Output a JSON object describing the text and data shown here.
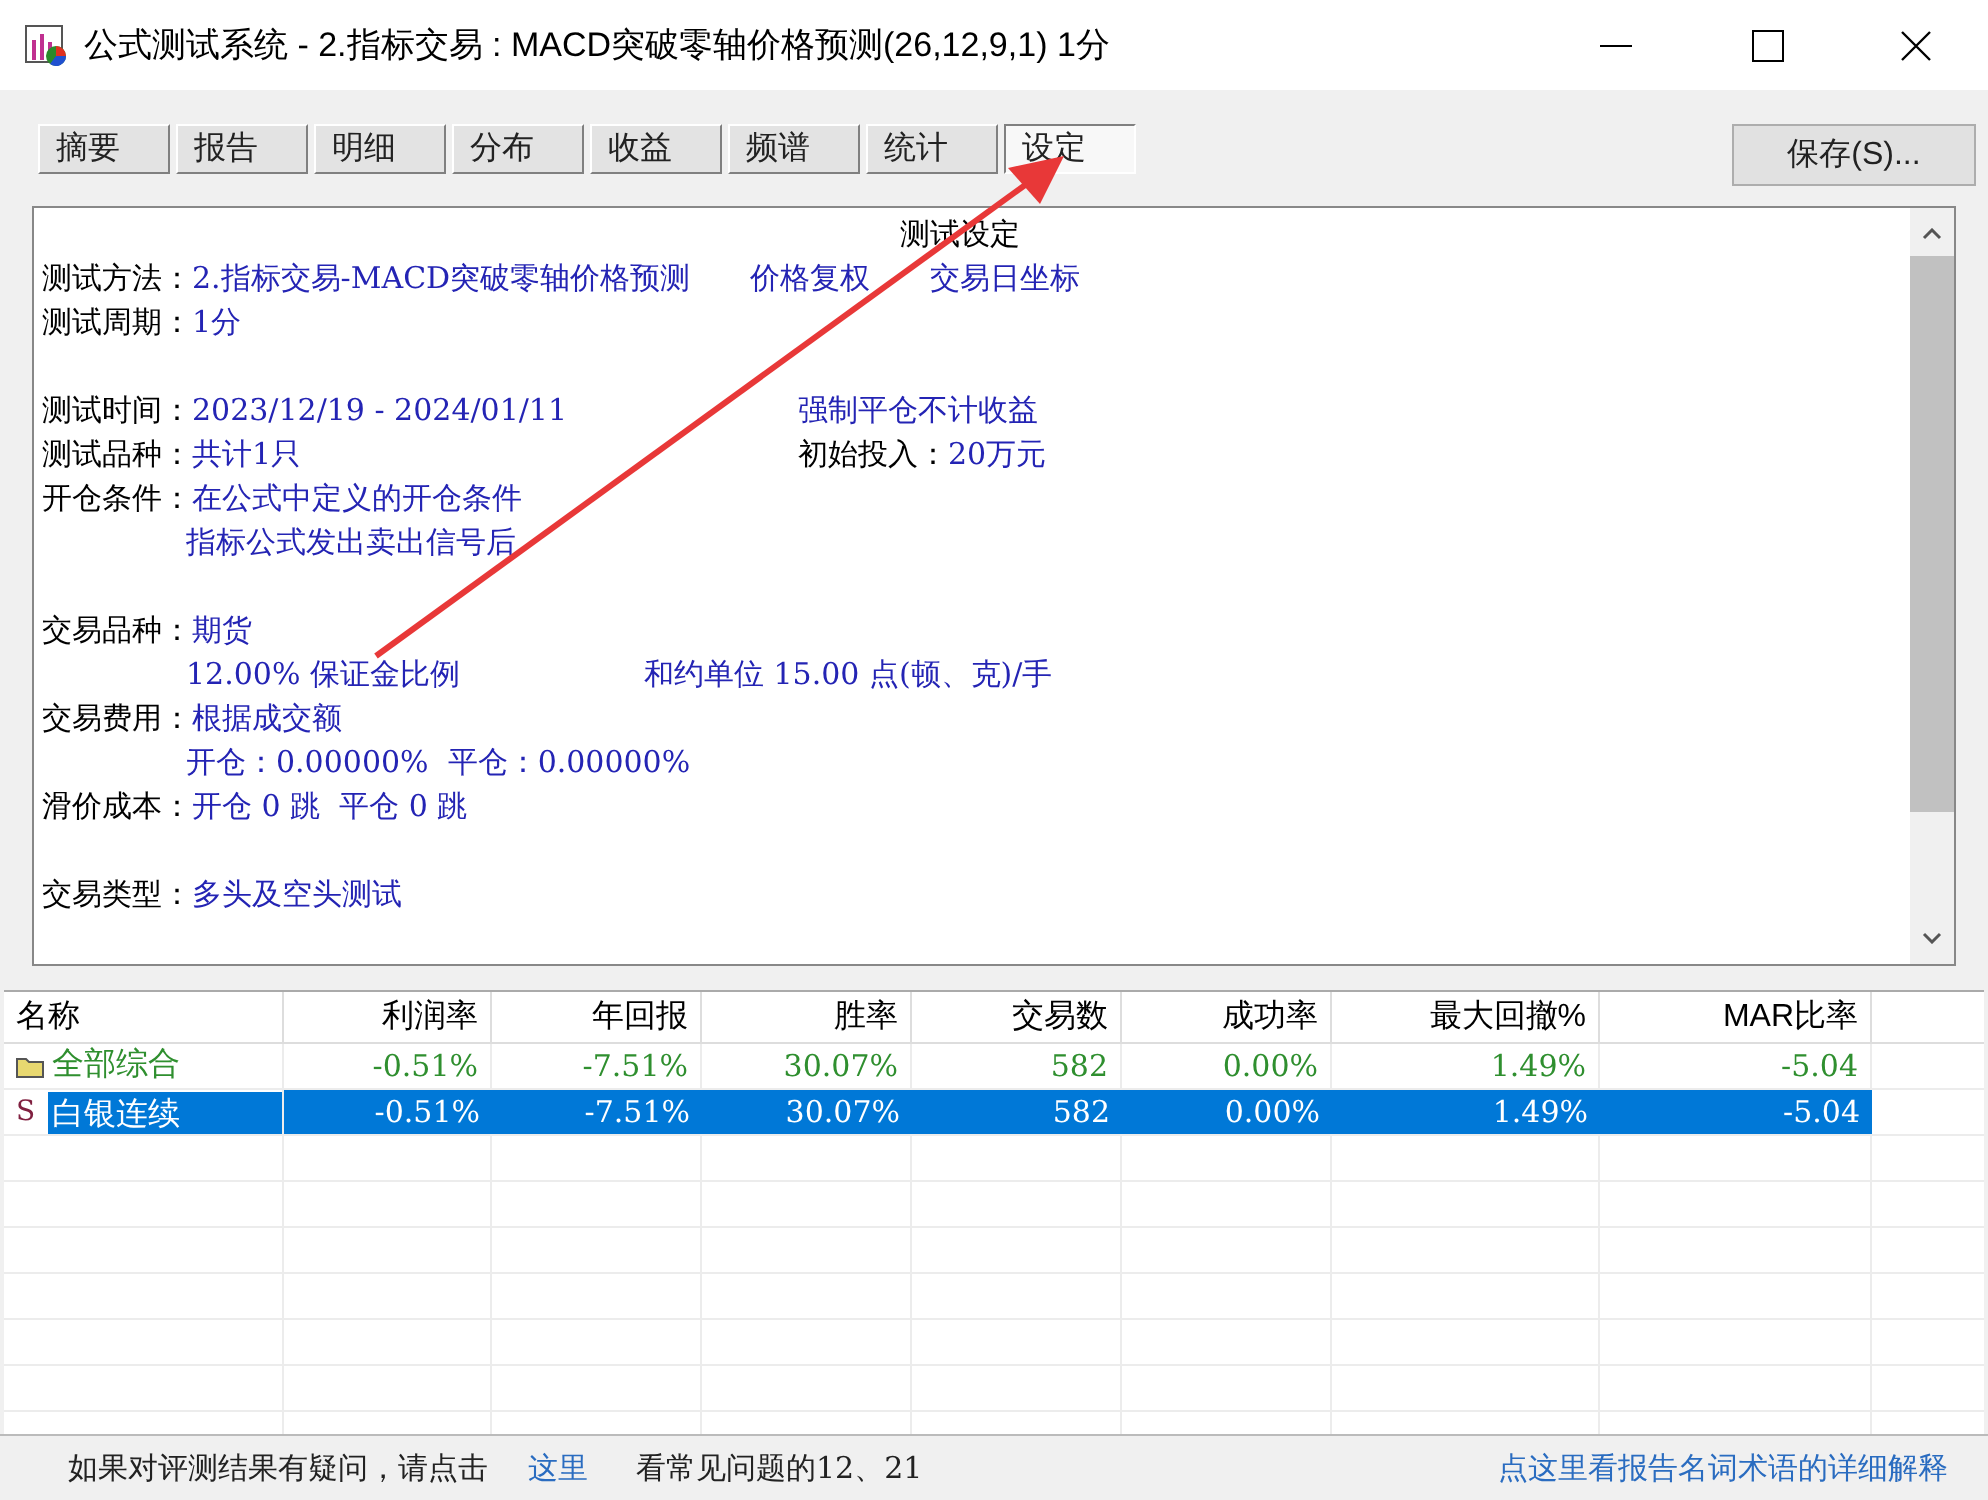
{
  "window": {
    "title": "公式测试系统 - 2.指标交易 : MACD突破零轴价格预测(26,12,9,1) 1分"
  },
  "tabs": [
    {
      "label": "摘要",
      "selected": false
    },
    {
      "label": "报告",
      "selected": false
    },
    {
      "label": "明细",
      "selected": false
    },
    {
      "label": "分布",
      "selected": false
    },
    {
      "label": "收益",
      "selected": false
    },
    {
      "label": "频谱",
      "selected": false
    },
    {
      "label": "统计",
      "selected": false
    },
    {
      "label": "设定",
      "selected": true
    }
  ],
  "save_button": "保存(S)...",
  "report": {
    "title": "测试设定",
    "lines": [
      {
        "label": "测试方法：",
        "value": "2.指标交易-MACD突破零轴价格预测",
        "extras": [
          {
            "kind": "gap",
            "value": "价格复权"
          },
          {
            "kind": "gap",
            "value": "交易日坐标"
          }
        ]
      },
      {
        "label": "测试周期：",
        "value": "1分"
      },
      {
        "kind": "blank"
      },
      {
        "label": "测试时间：",
        "value": "2023/12/19 - 2024/01/11",
        "extras": [
          {
            "kind": "column",
            "value": "强制平仓不计收益"
          }
        ]
      },
      {
        "label": "测试品种：",
        "value": "共计1只",
        "extras": [
          {
            "kind": "column",
            "label": "初始投入：",
            "value": "20万元"
          }
        ]
      },
      {
        "label": "开仓条件：",
        "value": "在公式中定义的开仓条件"
      },
      {
        "kind": "indent",
        "value": "指标公式发出卖出信号后"
      },
      {
        "kind": "blank"
      },
      {
        "label": "交易品种：",
        "value": "期货"
      },
      {
        "kind": "indent",
        "value": "12.00% 保证金比例",
        "extras": [
          {
            "kind": "wide",
            "value": "和约单位 15.00 点(顿、克)/手"
          }
        ]
      },
      {
        "label": "交易费用：",
        "value": "根据成交额"
      },
      {
        "kind": "indent",
        "value": "开仓：0.00000%  平仓：0.00000%"
      },
      {
        "label": "滑价成本：",
        "value": "开仓 0 跳  平仓 0 跳"
      },
      {
        "kind": "blank"
      },
      {
        "label": "交易类型：",
        "value": "多头及空头测试"
      }
    ]
  },
  "table": {
    "columns": [
      "名称",
      "利润率",
      "年回报",
      "胜率",
      "交易数",
      "成功率",
      "最大回撤%",
      "MAR比率"
    ],
    "rows": [
      {
        "kind": "group",
        "selected": false,
        "cells": [
          "全部综合",
          "-0.51%",
          "-7.51%",
          "30.07%",
          "582",
          "0.00%",
          "1.49%",
          "-5.04"
        ]
      },
      {
        "kind": "item",
        "icon_text": "S",
        "selected": true,
        "cells": [
          "白银连续",
          "-0.51%",
          "-7.51%",
          "30.07%",
          "582",
          "0.00%",
          "1.49%",
          "-5.04"
        ]
      }
    ]
  },
  "status_bar": {
    "text": "如果对评测结果有疑问，请点击",
    "link": "这里",
    "after": "看常见问题的12、21",
    "right_link": "点这里看报告名词术语的详细解释"
  }
}
